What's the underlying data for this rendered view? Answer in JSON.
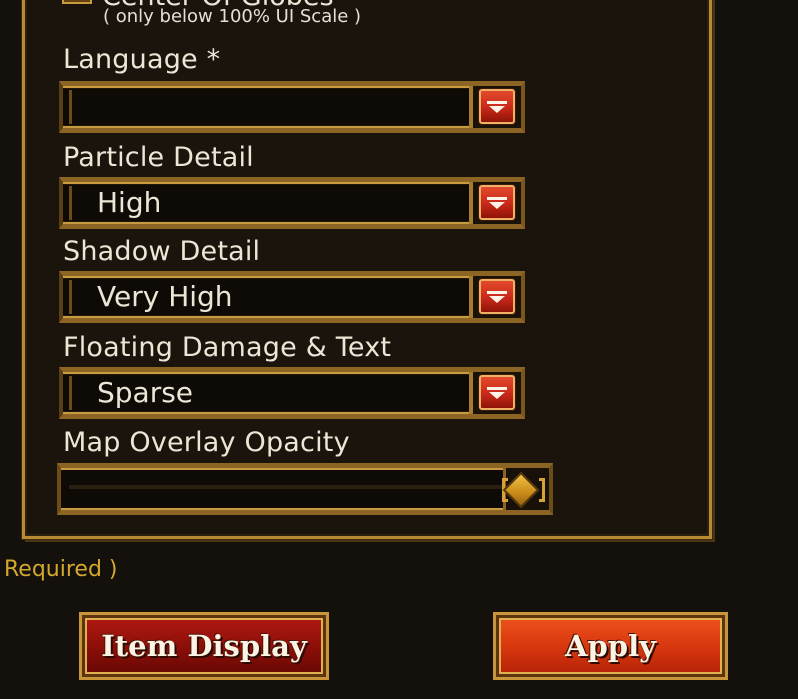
{
  "settings_panel": {
    "clipped_checkbox_label": "Center Of Globes",
    "scale_note": "( only below 100% UI Scale )",
    "language": {
      "label": "Language *",
      "value": ""
    },
    "particle_detail": {
      "label": "Particle Detail",
      "value": "High"
    },
    "shadow_detail": {
      "label": "Shadow Detail",
      "value": "Very High"
    },
    "floating_damage": {
      "label": "Floating Damage & Text",
      "value": "Sparse"
    },
    "map_overlay": {
      "label": "Map Overlay Opacity",
      "level": 1.0
    }
  },
  "footer": {
    "required_note": "Required )",
    "item_display_label": "Item Display",
    "apply_label": "Apply"
  },
  "colors": {
    "gold_border": "#b88a32",
    "dropdown_button": "#c8281a",
    "apply_button": "#d8380e",
    "item_display_button": "#8a0e08",
    "required_text": "#d4a82c"
  },
  "icons": [
    "chevron-down-icon",
    "slider-diamond-icon"
  ]
}
